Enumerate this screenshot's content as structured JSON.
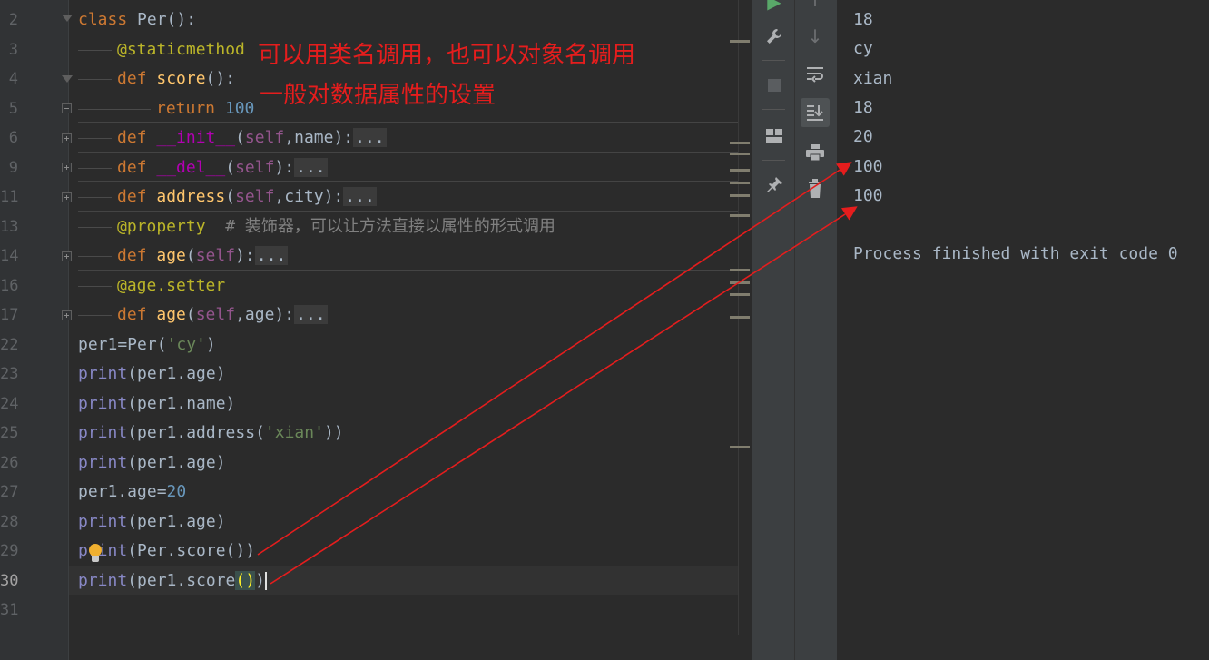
{
  "editor": {
    "line_numbers": [
      "2",
      "3",
      "4",
      "5",
      "6",
      "9",
      "11",
      "13",
      "14",
      "16",
      "17",
      "22",
      "23",
      "24",
      "25",
      "26",
      "27",
      "28",
      "29",
      "30",
      "31"
    ],
    "current_line": "30",
    "lines": [
      {
        "num": "2",
        "segments": [
          {
            "t": "class ",
            "c": "kw"
          },
          {
            "t": "Per",
            "c": "plain"
          },
          {
            "t": "():",
            "c": "plain"
          }
        ]
      },
      {
        "num": "3",
        "segments": [
          {
            "t": "@staticmethod",
            "c": "dec"
          }
        ]
      },
      {
        "num": "4",
        "segments": [
          {
            "t": "def ",
            "c": "kw"
          },
          {
            "t": "score",
            "c": "fn"
          },
          {
            "t": "():",
            "c": "plain"
          }
        ]
      },
      {
        "num": "5",
        "segments": [
          {
            "t": "return ",
            "c": "kw"
          },
          {
            "t": "100",
            "c": "num"
          }
        ]
      },
      {
        "num": "6",
        "segments": [
          {
            "t": "def ",
            "c": "kw"
          },
          {
            "t": "__init__",
            "c": "magic"
          },
          {
            "t": "(",
            "c": "plain"
          },
          {
            "t": "self",
            "c": "self"
          },
          {
            "t": ",name):",
            "c": "plain"
          },
          {
            "t": "...",
            "c": "fold"
          }
        ]
      },
      {
        "num": "9",
        "segments": [
          {
            "t": "def ",
            "c": "kw"
          },
          {
            "t": "__del__",
            "c": "magic"
          },
          {
            "t": "(",
            "c": "plain"
          },
          {
            "t": "self",
            "c": "self"
          },
          {
            "t": "):",
            "c": "plain"
          },
          {
            "t": "...",
            "c": "fold"
          }
        ]
      },
      {
        "num": "11",
        "segments": [
          {
            "t": "def ",
            "c": "kw"
          },
          {
            "t": "address",
            "c": "fn"
          },
          {
            "t": "(",
            "c": "plain"
          },
          {
            "t": "self",
            "c": "self"
          },
          {
            "t": ",city):",
            "c": "plain"
          },
          {
            "t": "...",
            "c": "fold"
          }
        ]
      },
      {
        "num": "13",
        "segments": [
          {
            "t": "@property",
            "c": "dec"
          },
          {
            "t": "  # 装饰器，可以让方法直接以属性的形式调用",
            "c": "cm"
          }
        ]
      },
      {
        "num": "14",
        "segments": [
          {
            "t": "def ",
            "c": "kw"
          },
          {
            "t": "age",
            "c": "fn"
          },
          {
            "t": "(",
            "c": "plain"
          },
          {
            "t": "self",
            "c": "self"
          },
          {
            "t": "):",
            "c": "plain"
          },
          {
            "t": "...",
            "c": "fold"
          }
        ]
      },
      {
        "num": "16",
        "segments": [
          {
            "t": "@age.setter",
            "c": "dec"
          }
        ]
      },
      {
        "num": "17",
        "segments": [
          {
            "t": "def ",
            "c": "kw"
          },
          {
            "t": "age",
            "c": "fn"
          },
          {
            "t": "(",
            "c": "plain"
          },
          {
            "t": "self",
            "c": "self"
          },
          {
            "t": ",age):",
            "c": "plain"
          },
          {
            "t": "...",
            "c": "fold"
          }
        ]
      },
      {
        "num": "22",
        "segments": [
          {
            "t": "per1=Per(",
            "c": "plain"
          },
          {
            "t": "'cy'",
            "c": "str"
          },
          {
            "t": ")",
            "c": "plain"
          }
        ]
      },
      {
        "num": "23",
        "segments": [
          {
            "t": "print",
            "c": "bi"
          },
          {
            "t": "(per1.age)",
            "c": "plain"
          }
        ]
      },
      {
        "num": "24",
        "segments": [
          {
            "t": "print",
            "c": "bi"
          },
          {
            "t": "(per1.name)",
            "c": "plain"
          }
        ]
      },
      {
        "num": "25",
        "segments": [
          {
            "t": "print",
            "c": "bi"
          },
          {
            "t": "(per1.address(",
            "c": "plain"
          },
          {
            "t": "'xian'",
            "c": "str"
          },
          {
            "t": "))",
            "c": "plain"
          }
        ]
      },
      {
        "num": "26",
        "segments": [
          {
            "t": "print",
            "c": "bi"
          },
          {
            "t": "(per1.age)",
            "c": "plain"
          }
        ]
      },
      {
        "num": "27",
        "segments": [
          {
            "t": "per1.age=",
            "c": "plain"
          },
          {
            "t": "20",
            "c": "num"
          }
        ]
      },
      {
        "num": "28",
        "segments": [
          {
            "t": "print",
            "c": "bi"
          },
          {
            "t": "(per1.age)",
            "c": "plain"
          }
        ]
      },
      {
        "num": "29",
        "segments": [
          {
            "t": "print",
            "c": "bi"
          },
          {
            "t": "(Per.score())",
            "c": "plain"
          }
        ]
      },
      {
        "num": "30",
        "segments": [
          {
            "t": "print",
            "c": "bi"
          },
          {
            "t": "(per1.score",
            "c": "plain"
          },
          {
            "t": "()",
            "c": "brk"
          },
          {
            "t": ")",
            "c": "plain"
          }
        ]
      },
      {
        "num": "31",
        "segments": []
      }
    ]
  },
  "annotations": {
    "note1": "可以用类名调用，也可以对象名调用",
    "note2": "一般对数据属性的设置"
  },
  "console": {
    "lines": [
      "18",
      "cy",
      "xian",
      "18",
      "20",
      "100",
      "100",
      "",
      "Process finished with exit code 0"
    ]
  },
  "toolbar_left": [
    "run-icon",
    "wrench-icon",
    "stop-icon",
    "layout-icon",
    "pin-icon"
  ],
  "toolbar_right": [
    "up-icon",
    "down-icon",
    "soft-wrap-icon",
    "scroll-to-end-icon",
    "print-icon",
    "trash-icon"
  ],
  "colors": {
    "background": "#2b2b2b",
    "keyword": "#cc7832",
    "function": "#ffc66d",
    "decorator": "#bbb529",
    "number": "#6897bb",
    "string": "#6a8759",
    "annotation": "#e51d1d"
  }
}
